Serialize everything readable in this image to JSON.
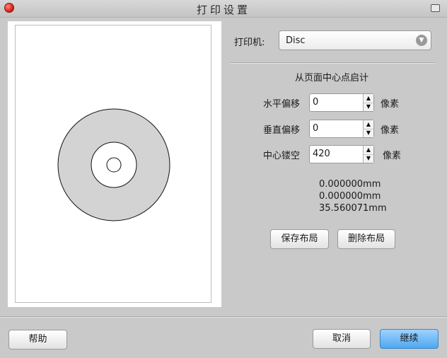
{
  "window": {
    "title": "打印设置"
  },
  "form": {
    "printer_label": "打印机:",
    "printer_value": "Disc",
    "section_title": "从页面中心点启计",
    "horizontal_label": "水平偏移",
    "horizontal_value": "0",
    "vertical_label": "垂直偏移",
    "vertical_value": "0",
    "center_label": "中心镂空",
    "center_value": "420",
    "unit_label": "像素",
    "mm_horizontal": "0.000000mm",
    "mm_vertical": "0.000000mm",
    "mm_center": "35.560071mm"
  },
  "buttons": {
    "save_layout": "保存布局",
    "delete_layout": "删除布局",
    "help": "帮助",
    "cancel": "取消",
    "continue": "继续"
  },
  "icons": {
    "close": "close-icon",
    "restore": "restore-icon",
    "dropdown": "chevron-down-icon",
    "spin_up": "arrow-up-icon",
    "spin_down": "arrow-down-icon"
  },
  "colors": {
    "disc_fill": "#d3d3d3",
    "primary_button": "#4ea8f0"
  }
}
